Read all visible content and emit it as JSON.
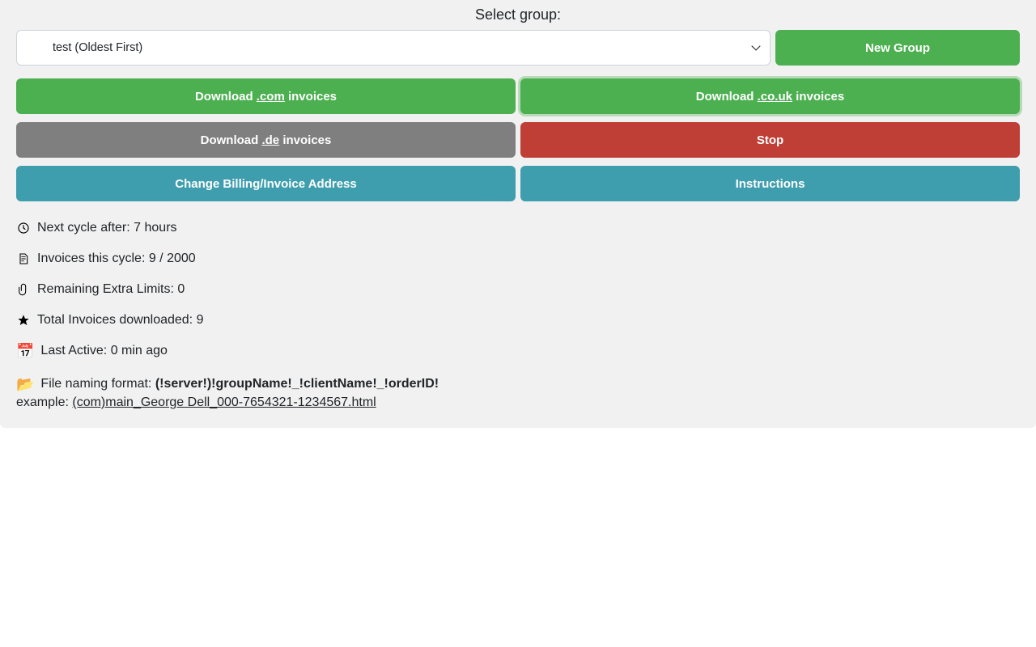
{
  "header": {
    "label": "Select group:"
  },
  "group_select": {
    "selected": "test (Oldest First)"
  },
  "buttons": {
    "new_group": "New Group",
    "download_com_pre": "Download ",
    "download_com_mid": ".com",
    "download_com_post": " invoices",
    "download_couk_pre": "Download ",
    "download_couk_mid": ".co.uk",
    "download_couk_post": " invoices",
    "download_de_pre": "Download ",
    "download_de_mid": ".de",
    "download_de_post": " invoices",
    "stop": "Stop",
    "change_billing": "Change Billing/Invoice Address",
    "instructions": "Instructions"
  },
  "stats": {
    "next_cycle": "Next cycle after: 7 hours",
    "invoices_cycle": "Invoices this cycle: 9 / 2000",
    "remaining_limits": "Remaining Extra Limits: 0",
    "total_downloaded": "Total Invoices downloaded: 9",
    "last_active": "Last Active: 0 min ago"
  },
  "file_format": {
    "label_pre": "File naming format: ",
    "format": "(!server!)!groupName!_!clientName!_!orderID!",
    "example_pre": "example: ",
    "example": "(com)main_George Dell_000-7654321-1234567.html"
  }
}
